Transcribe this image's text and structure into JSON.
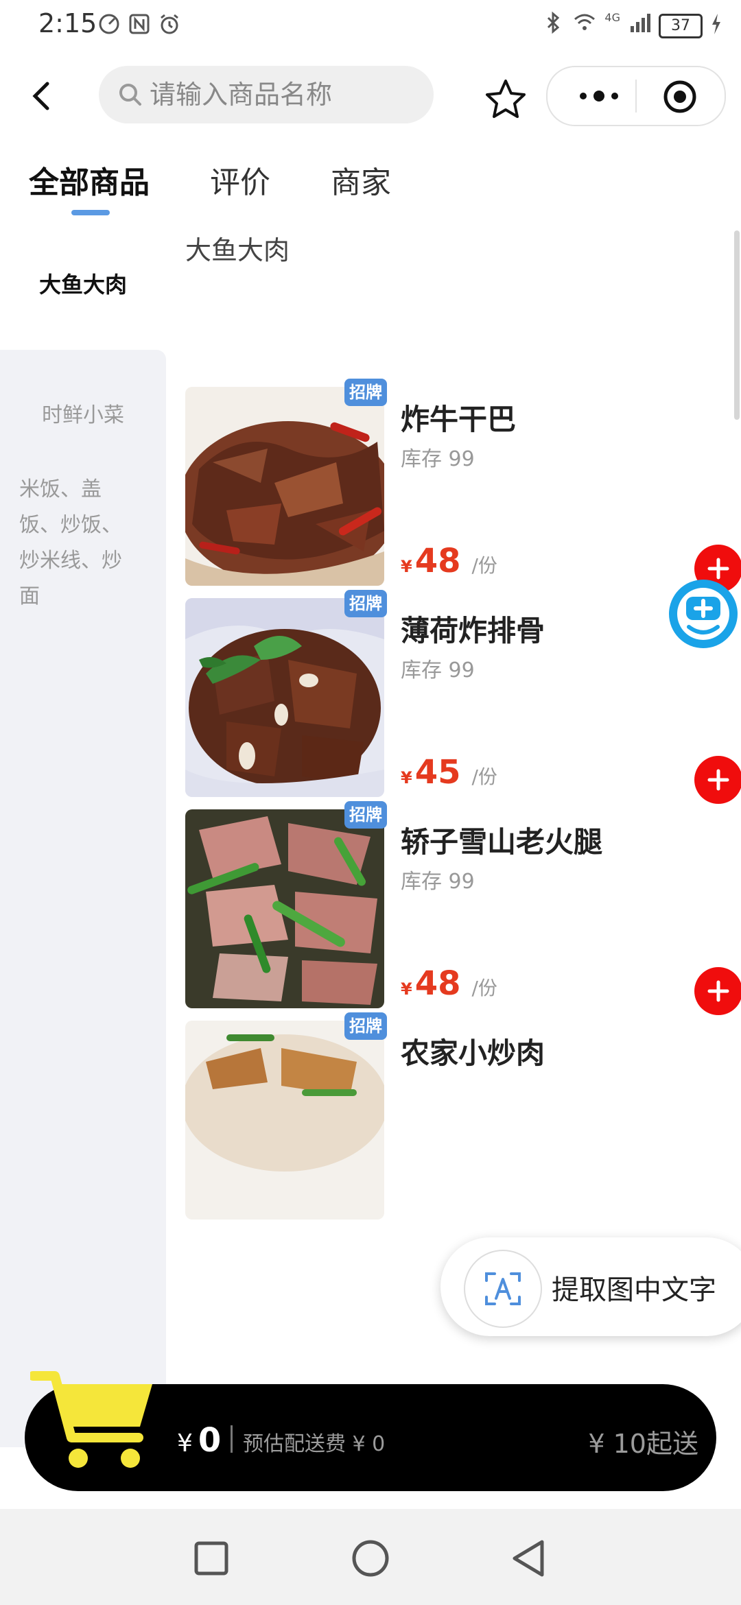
{
  "status_bar": {
    "time": "2:15",
    "battery": "37",
    "network": "4G"
  },
  "search": {
    "placeholder": "请输入商品名称"
  },
  "tabs": [
    {
      "label": "全部商品",
      "active": true
    },
    {
      "label": "评价",
      "active": false
    },
    {
      "label": "商家",
      "active": false
    }
  ],
  "sidebar": {
    "items": [
      {
        "label": "大鱼大肉",
        "active": true
      },
      {
        "label": "时鲜小菜",
        "active": false
      },
      {
        "label": "米饭、盖饭、炒饭、炒米线、炒面",
        "lines": [
          "米饭、盖",
          "饭、炒饭、",
          "炒米线、炒",
          "面"
        ],
        "active": false
      }
    ]
  },
  "section": {
    "title": "大鱼大肉"
  },
  "products": [
    {
      "name": "炸牛干巴",
      "stock": "库存 99",
      "currency": "¥",
      "price": "48",
      "unit": "/份",
      "badge": "招牌"
    },
    {
      "name": "薄荷炸排骨",
      "stock": "库存 99",
      "currency": "¥",
      "price": "45",
      "unit": "/份",
      "badge": "招牌"
    },
    {
      "name": "轿子雪山老火腿",
      "stock": "库存 99",
      "currency": "¥",
      "price": "48",
      "unit": "/份",
      "badge": "招牌"
    },
    {
      "name": "农家小炒肉",
      "stock": "",
      "currency": "",
      "price": "",
      "unit": "",
      "badge": "招牌"
    }
  ],
  "ocr_pill": {
    "label": "提取图中文字"
  },
  "cart": {
    "currency": "¥",
    "total": "0",
    "delivery": "预估配送费 ¥ 0",
    "minimum": "¥ 10起送"
  },
  "colors": {
    "accent_blue": "#5b9ae3",
    "price_red": "#e53a1f",
    "add_button_red": "#f00d0d",
    "cart_bar": "#000000",
    "cart_icon_yellow": "#f5e63a",
    "badge_blue": "#4f8fdc"
  },
  "icons": {
    "back": "chevron-left-icon",
    "search": "search-icon",
    "favorite": "star-icon",
    "more": "more-dots-icon",
    "close_miniprogram": "target-icon",
    "add": "plus-icon",
    "cart": "shopping-cart-icon",
    "ocr": "text-recognition-icon",
    "assistant": "floating-assistant-icon"
  }
}
